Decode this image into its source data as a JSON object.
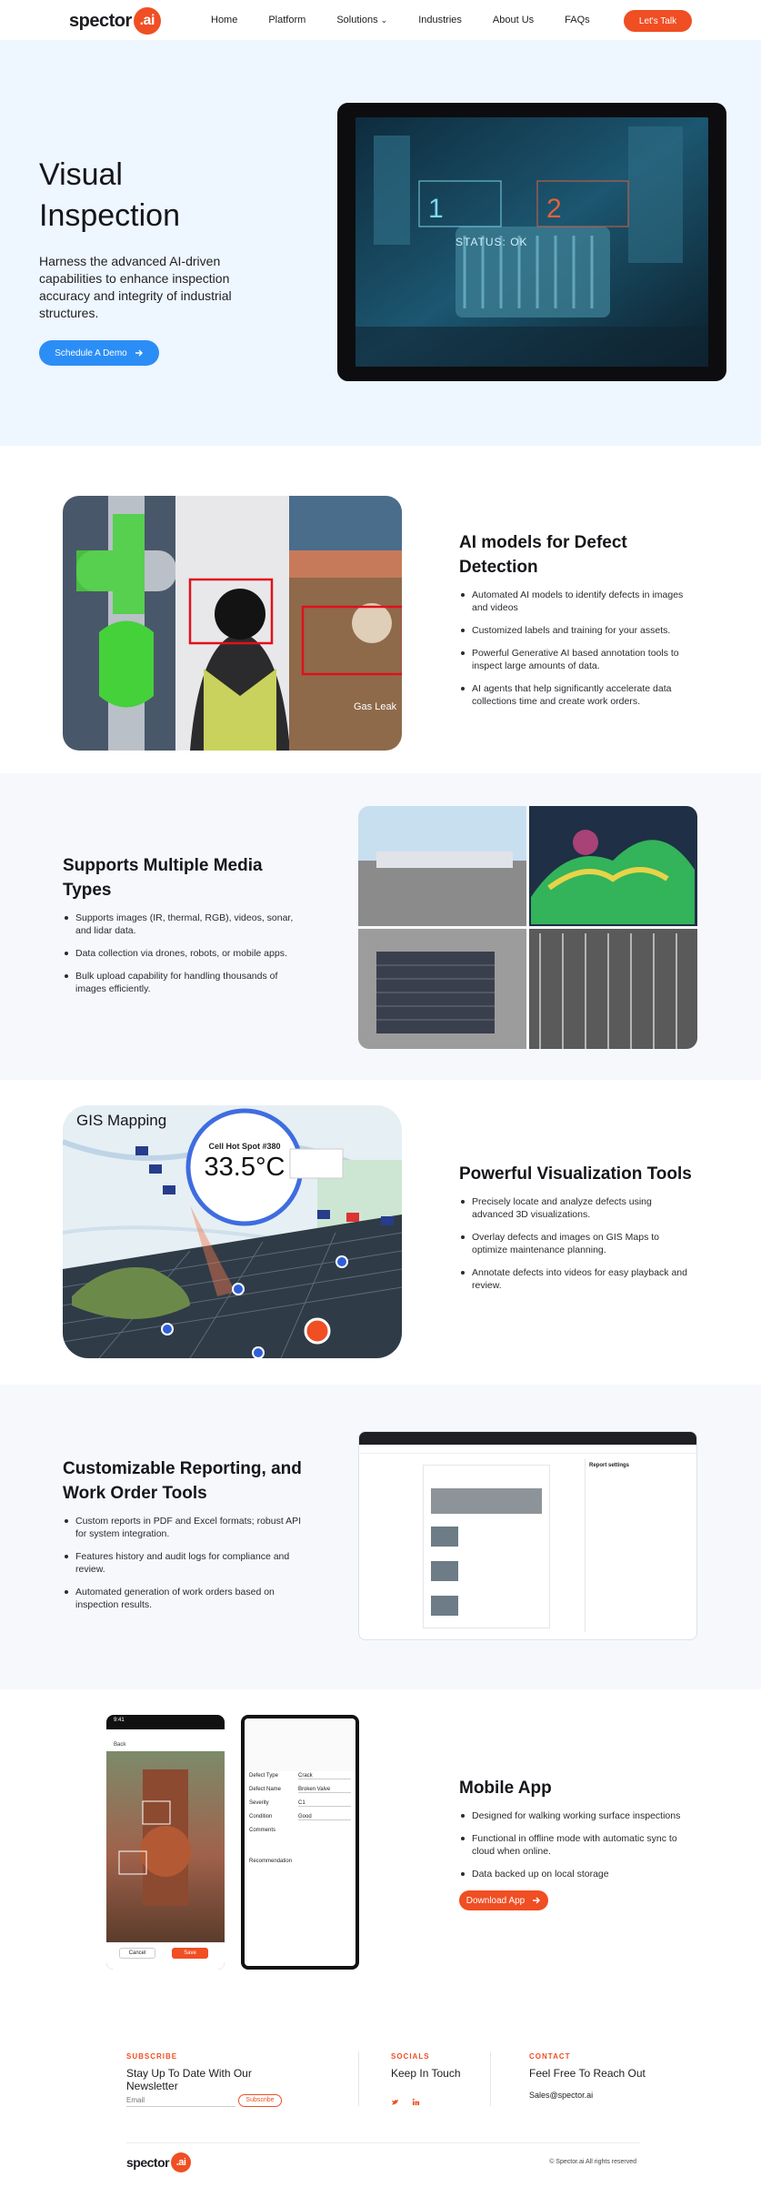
{
  "nav": {
    "logo_text": "spector",
    "logo_badge": ".ai",
    "items": [
      {
        "label": "Home"
      },
      {
        "label": "Platform"
      },
      {
        "label": "Solutions"
      },
      {
        "label": "Industries"
      },
      {
        "label": "About Us"
      },
      {
        "label": "FAQs"
      }
    ],
    "solutions_chevron": "⌄",
    "cta": "Let's Talk"
  },
  "hero": {
    "title_line1": "Visual",
    "title_line2": "Inspection",
    "description": "Harness the advanced AI-driven capabilities to enhance inspection accuracy and integrity of industrial structures.",
    "demo_button": "Schedule A Demo",
    "overlay_status": "STATUS: OK",
    "overlay_num1": "1",
    "overlay_num2": "2"
  },
  "ai_models": {
    "title": "AI models for Defect Detection",
    "bullets": [
      "Automated AI models to identify defects in images and videos",
      "Customized labels and training for your assets.",
      "Powerful Generative AI based annotation tools to inspect large amounts of data.",
      "AI agents that help significantly accelerate data collections time and create work orders."
    ],
    "image_label": "Gas Leak"
  },
  "media": {
    "title": "Supports Multiple Media Types",
    "bullets": [
      "Supports images (IR, thermal, RGB), videos, sonar, and lidar data.",
      "Data collection via drones, robots, or mobile apps.",
      "Bulk upload capability for handling thousands of images efficiently."
    ]
  },
  "visualization": {
    "title": "Powerful Visualization Tools",
    "bullets": [
      "Precisely locate and analyze defects using advanced 3D visualizations.",
      "Overlay defects and images on GIS Maps to optimize maintenance planning.",
      "Annotate defects into videos for easy playback and review."
    ],
    "map_label": "GIS Mapping",
    "hotspot_label": "Cell Hot Spot #380",
    "hotspot_value": "33.5°C"
  },
  "reporting": {
    "title": "Customizable Reporting, and Work Order Tools",
    "bullets": [
      "Custom reports in PDF and Excel formats; robust API for system integration.",
      "Features history and audit logs for compliance and review.",
      "Automated generation of work orders based on inspection results."
    ],
    "panel_title": "Report settings"
  },
  "mobile": {
    "title": "Mobile App",
    "bullets": [
      "Designed for walking working surface inspections",
      "Functional in offline mode with automatic sync to cloud when online.",
      "Data backed up on local storage"
    ],
    "download_button": "Download App",
    "phone_time": "9:41",
    "phone_back": "Back",
    "phone_cancel": "Cancel",
    "phone_save": "Save",
    "form_fields": [
      {
        "label": "Defect Type",
        "value": "Crack"
      },
      {
        "label": "Defect Name",
        "value": "Broken Valve"
      },
      {
        "label": "Severity",
        "value": "C1"
      },
      {
        "label": "Condition",
        "value": "Good"
      },
      {
        "label": "Comments",
        "value": ""
      },
      {
        "label": "Recommendation",
        "value": ""
      }
    ]
  },
  "footer": {
    "subscribe_label": "SUBSCRIBE",
    "subscribe_title": "Stay Up To Date With Our Newsletter",
    "email_placeholder": "Email",
    "subscribe_button": "Subscribe",
    "socials_label": "SOCIALS",
    "socials_title": "Keep In Touch",
    "contact_label": "CONTACT",
    "contact_title": "Feel Free To Reach Out",
    "contact_email": "Sales@spector.ai",
    "copyright": "© Spector.ai All rights reserved",
    "logo_text": "spector",
    "logo_badge": ".ai"
  },
  "colors": {
    "accent": "#f04e23",
    "blue": "#2b8ef6",
    "hero_bg": "#eef6ff",
    "alt_bg": "#f6f8fc"
  }
}
